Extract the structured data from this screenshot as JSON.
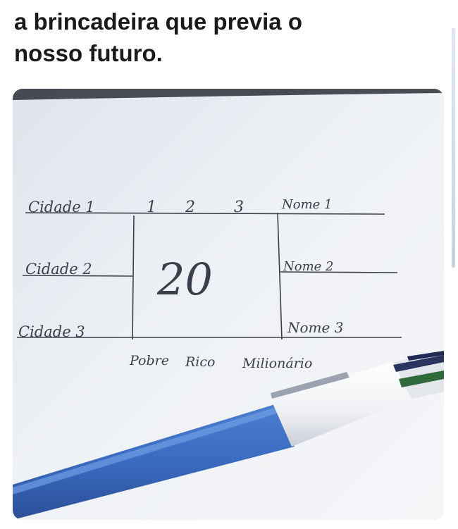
{
  "caption": {
    "line1": "a brincadeira que previa o",
    "line2": "nosso futuro."
  },
  "photo": {
    "handwriting": {
      "cities": [
        "Cidade 1",
        "Cidade 2",
        "Cidade 3"
      ],
      "numbers": [
        "1",
        "2",
        "3"
      ],
      "names": [
        "Nome 1",
        "Nome 2",
        "Nome 3"
      ],
      "center_number": "20",
      "outcomes": [
        "Pobre",
        "Rico",
        "Milionário"
      ]
    },
    "pen_icon": "ballpoint-pen-icon"
  }
}
